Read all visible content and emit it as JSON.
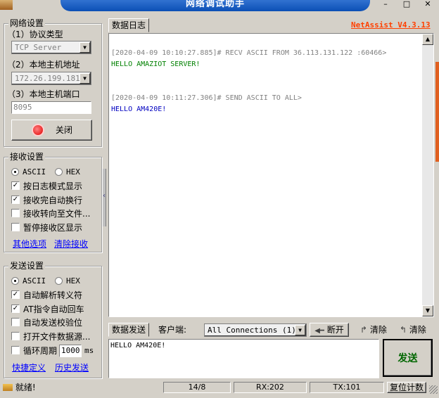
{
  "window": {
    "title": "网络调试助手",
    "min": "–",
    "max": "□",
    "close": "✕"
  },
  "net_settings": {
    "title": "网络设置",
    "protocol_label": "（1）协议类型",
    "protocol_value": "TCP Server",
    "host_label": "（2）本地主机地址",
    "host_value": "172.26.199.181",
    "port_label": "（3）本地主机端口",
    "port_value": "8095",
    "close_button": "关闭"
  },
  "recv_settings": {
    "title": "接收设置",
    "ascii": "ASCII",
    "hex": "HEX",
    "options": [
      {
        "label": "按日志模式显示",
        "checked": true
      },
      {
        "label": "接收完自动换行",
        "checked": true
      },
      {
        "label": "接收转向至文件...",
        "checked": false
      },
      {
        "label": "暂停接收区显示",
        "checked": false
      }
    ],
    "more_link": "其他选项",
    "clear_link": "清除接收"
  },
  "send_settings": {
    "title": "发送设置",
    "ascii": "ASCII",
    "hex": "HEX",
    "options": [
      {
        "label": "自动解析转义符",
        "checked": true
      },
      {
        "label": "AT指令自动回车",
        "checked": true
      },
      {
        "label": "自动发送校验位",
        "checked": false
      },
      {
        "label": "打开文件数据源...",
        "checked": false
      }
    ],
    "loop_label": "循环周期",
    "loop_value": "1000",
    "loop_unit": "ms",
    "shortcut_link": "快捷定义",
    "history_link": "历史发送"
  },
  "log": {
    "tab": "数据日志",
    "brand": "NetAssist V4.3.13",
    "lines": [
      {
        "text": "[2020-04-09 10:10:27.885]# RECV ASCII FROM 36.113.131.122 :60466>",
        "color": "#808080"
      },
      {
        "text": "HELLO AMAZIOT SERVER!",
        "color": "#008000"
      },
      {
        "text": "[2020-04-09 10:11:27.306]# SEND ASCII TO ALL>",
        "color": "#808080"
      },
      {
        "text": "HELLO AM420E!",
        "color": "#0000c0"
      }
    ]
  },
  "send_bar": {
    "tab": "数据发送",
    "client_label": "客户端:",
    "client_value": "All Connections (1)",
    "disconnect_button": "断开",
    "clear_button_1": "清除",
    "clear_button_2": "清除",
    "input_value": "HELLO AM420E!",
    "send_button": "发送"
  },
  "status": {
    "ready": "就绪!",
    "count": "14/8",
    "rx": "RX:202",
    "tx": "TX:101",
    "reset_button": "复位计数"
  }
}
